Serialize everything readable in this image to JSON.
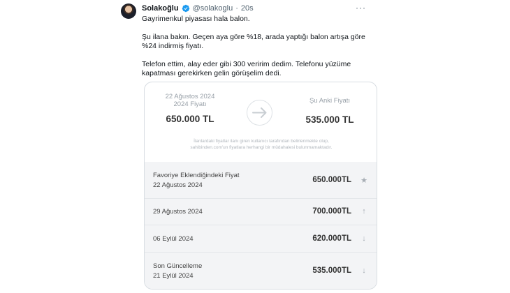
{
  "tweet": {
    "author_name": "Solakoğlu",
    "handle": "@solakoglu",
    "separator": "·",
    "time": "20s",
    "more_icon": "more-icon",
    "paragraphs": [
      "Gayrimenkul piyasası hala balon.",
      "Şu ilana bakın. Geçen aya göre %18, arada yaptığı balon artışa göre %24 indirmiş fiyatı.",
      "Telefon ettim, alay eder gibi 300 veririm dedim. Telefonu yüzüme kapatması gerekirken gelin görüşelim dedi."
    ]
  },
  "card": {
    "left": {
      "line1": "22 Ağustos 2024",
      "line2": "2024 Fiyatı",
      "price": "650.000 TL"
    },
    "right": {
      "label": "Şu Anki Fiyatı",
      "price": "535.000 TL"
    },
    "disclaimer_line1": "İlanlardaki fiyatlar ilanı giren kullanıcı tarafından belirlenmekte olup,",
    "disclaimer_line2": "sahibinden.com'un fiyatlara herhangi bir müdahalesi bulunmamaktadır.",
    "history": [
      {
        "title": "Favoriye Eklendiğindeki Fiyat",
        "date": "22 Ağustos 2024",
        "price": "650.000TL",
        "icon": "star-icon"
      },
      {
        "title": "",
        "date": "29 Ağustos 2024",
        "price": "700.000TL",
        "icon": "arrow-up-icon"
      },
      {
        "title": "",
        "date": "06 Eylül 2024",
        "price": "620.000TL",
        "icon": "arrow-down-icon"
      },
      {
        "title": "Son Güncelleme",
        "date": "21 Eylül 2024",
        "price": "535.000TL",
        "icon": "arrow-down-icon"
      }
    ]
  },
  "colors": {
    "verified": "#1d9bf0",
    "muted": "#536471",
    "history_bg": "#f3f4f6"
  }
}
